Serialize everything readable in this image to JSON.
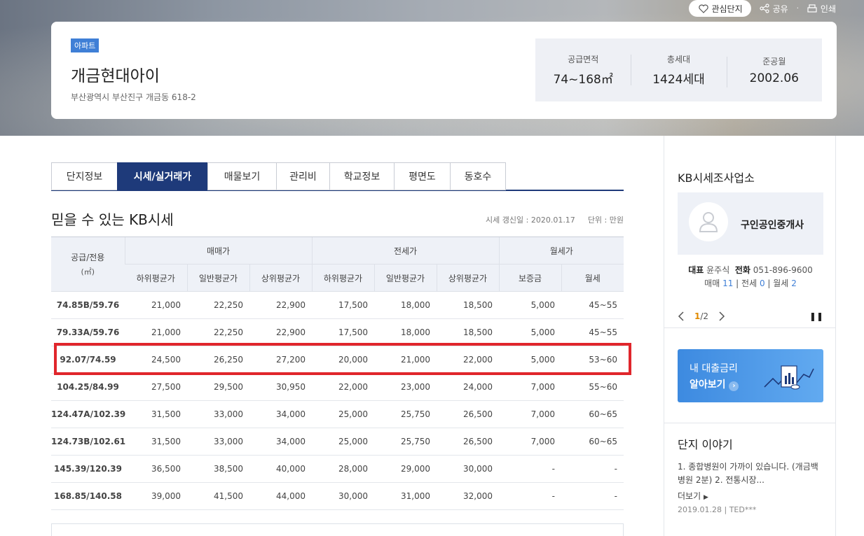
{
  "top_actions": {
    "favorite": "관심단지",
    "share": "공유",
    "print": "인쇄"
  },
  "summary": {
    "badge": "아파트",
    "name": "개금현대아이",
    "address": "부산광역시 부산진구 개금동 618-2",
    "stats": [
      {
        "label": "공급면적",
        "value": "74~168㎡"
      },
      {
        "label": "총세대",
        "value": "1424세대"
      },
      {
        "label": "준공월",
        "value": "2002.06"
      }
    ]
  },
  "tabs": [
    {
      "label": "단지정보",
      "active": false
    },
    {
      "label": "시세/실거래가",
      "active": true
    },
    {
      "label": "매물보기",
      "active": false
    },
    {
      "label": "관리비",
      "active": false
    },
    {
      "label": "학교정보",
      "active": false
    },
    {
      "label": "평면도",
      "active": false
    },
    {
      "label": "동호수",
      "active": false
    }
  ],
  "section": {
    "title": "믿을 수 있는 KB시세",
    "updated": "시세 갱신일 : 2020.01.17",
    "unit": "단위 : 만원"
  },
  "table": {
    "area_header": "공급/전용",
    "area_unit": "(㎡)",
    "groups": [
      "매매가",
      "전세가",
      "월세가"
    ],
    "subheaders": [
      "하위평균가",
      "일반평균가",
      "상위평균가",
      "하위평균가",
      "일반평균가",
      "상위평균가",
      "보증금",
      "월세"
    ],
    "rows": [
      [
        "74.85B/59.76",
        "21,000",
        "22,250",
        "22,900",
        "17,500",
        "18,000",
        "18,500",
        "5,000",
        "45~55"
      ],
      [
        "79.33A/59.76",
        "21,000",
        "22,250",
        "22,900",
        "17,500",
        "18,000",
        "18,500",
        "5,000",
        "45~55"
      ],
      [
        "92.07/74.59",
        "24,500",
        "26,250",
        "27,200",
        "20,000",
        "21,000",
        "22,000",
        "5,000",
        "53~60"
      ],
      [
        "104.25/84.99",
        "27,500",
        "29,500",
        "30,950",
        "22,000",
        "23,000",
        "24,000",
        "7,000",
        "55~60"
      ],
      [
        "124.47A/102.39",
        "31,500",
        "33,000",
        "34,000",
        "25,000",
        "25,750",
        "26,500",
        "7,000",
        "60~65"
      ],
      [
        "124.73B/102.61",
        "31,500",
        "33,000",
        "34,000",
        "25,000",
        "25,750",
        "26,500",
        "7,000",
        "60~65"
      ],
      [
        "145.39/120.39",
        "36,500",
        "38,500",
        "40,000",
        "28,000",
        "29,000",
        "30,000",
        "-",
        "-"
      ],
      [
        "168.85/140.58",
        "39,000",
        "41,500",
        "44,000",
        "30,000",
        "31,000",
        "32,000",
        "-",
        "-"
      ]
    ],
    "highlighted_row": 2
  },
  "sidebar": {
    "title": "KB시세조사업소",
    "agent_name": "구인공인중개사",
    "rep_label": "대표",
    "rep_name": "윤주식",
    "phone_label": "전화",
    "phone": "051-896-9600",
    "sale_label": "매매",
    "sale_count": "11",
    "jeonse_label": "전세",
    "jeonse_count": "0",
    "monthly_label": "월세",
    "monthly_count": "2",
    "page_current": "1",
    "page_total": "/2",
    "loan_line1": "내 대출금리",
    "loan_line2": "알아보기",
    "story_title": "단지 이야기",
    "story_text": "1. 종합병원이 가까이 있습니다. (개금백병원 2분) 2. 전통시장...",
    "more": "더보기",
    "story_date": "2019.01.28",
    "story_author": "TED***"
  }
}
